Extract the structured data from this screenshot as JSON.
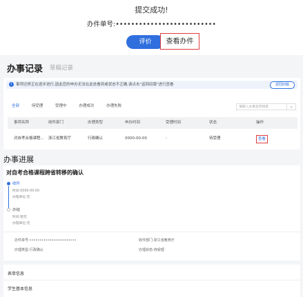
{
  "header": {
    "success_text": "提交成功!",
    "order_label": "办件单号:",
    "order_value": "••••••••••••••••••••••••••",
    "rate_button": "评价",
    "view_button": "查看办件"
  },
  "records": {
    "title": "办事记录",
    "draft_tab": "草稿记录",
    "notice_text": "事项迁移正在逐步进行,因此您的申办无法在此处看到或状态不正确,请点击\"返回旧版\"进行查看",
    "back_button": "返回旧版",
    "tabs": [
      "全部",
      "待受理",
      "受理中",
      "办理成功",
      "办理失败"
    ],
    "search_placeholder": "请输入办事名称搜索",
    "columns": [
      "事项名称",
      "收件部门",
      "办理类型",
      "申办时间",
      "受理时间",
      "状态",
      "操作"
    ],
    "rows": [
      {
        "name": "对自考合格课程...",
        "dept": "浙江省教育厅",
        "type": "行政确认",
        "apply_time": "0000-00-00",
        "accept_time": "-",
        "status": "待受理",
        "action": "查看"
      }
    ]
  },
  "progress": {
    "title": "办事进展",
    "process_name": "对自考合格课程跨省转移的确认",
    "steps": [
      {
        "name": "收件",
        "time": "时间:0000-00-00",
        "dept": "办理单位:无"
      },
      {
        "name": "办结",
        "time": "时间:暂无",
        "dept": "办理单位:无"
      }
    ],
    "info": {
      "order_label": "办件单号:",
      "order_value": "•••••••••••••••••••••••",
      "receive_dept_label": "收件部门:",
      "receive_dept_value": "浙江省教育厅",
      "type_label": "办理类型:",
      "type_value": "行政确认",
      "status_label": "办理状态:",
      "status_value": "待受理"
    }
  },
  "form": {
    "sheet_title": "表单信息",
    "student_info": "学生基本信息"
  }
}
